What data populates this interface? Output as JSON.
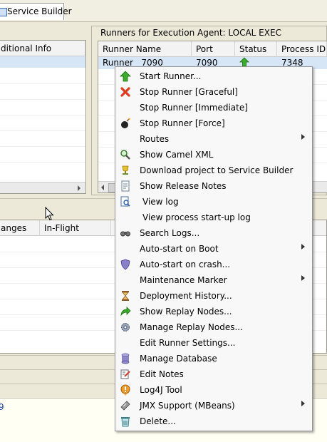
{
  "tab": {
    "label": "Service Builder"
  },
  "left_panel": {
    "col_header": "ditional Info"
  },
  "right_panel": {
    "title": "Runners for Execution Agent: LOCAL EXEC",
    "columns": [
      "Runner Name",
      "Port",
      "Status",
      "Process ID"
    ],
    "row": {
      "name": "Runner   7090",
      "port": "7090",
      "pid": "7348"
    }
  },
  "bottom_panel": {
    "columns": [
      "anges",
      "In-Flight"
    ]
  },
  "bottom_fragment": "9",
  "context_menu": {
    "items": [
      {
        "label": "Start Runner...",
        "icon": "green-up-arrow-icon",
        "submenu": false
      },
      {
        "label": "Stop Runner [Graceful]",
        "icon": "red-x-icon",
        "submenu": false
      },
      {
        "label": "Stop Runner [Immediate]",
        "icon": "",
        "submenu": false
      },
      {
        "label": "Stop Runner [Force]",
        "icon": "bomb-icon",
        "submenu": false
      },
      {
        "label": "Routes",
        "icon": "",
        "submenu": true
      },
      {
        "label": "Show Camel XML",
        "icon": "magnifier-icon",
        "submenu": false
      },
      {
        "label": "Download project to Service Builder",
        "icon": "trophy-icon",
        "submenu": false
      },
      {
        "label": "Show Release Notes",
        "icon": "document-icon",
        "submenu": false
      },
      {
        "label": "View log",
        "icon": "log-viewer-icon",
        "submenu": false
      },
      {
        "label": "View process start-up log",
        "icon": "",
        "submenu": false
      },
      {
        "label": "Search Logs...",
        "icon": "binoculars-icon",
        "submenu": false
      },
      {
        "label": "Auto-start on Boot",
        "icon": "",
        "submenu": true
      },
      {
        "label": "Auto-start on crash...",
        "icon": "shield-icon",
        "submenu": false
      },
      {
        "label": "Maintenance Marker",
        "icon": "",
        "submenu": true
      },
      {
        "label": "Deployment History...",
        "icon": "hourglass-icon",
        "submenu": false
      },
      {
        "label": "Show Replay Nodes...",
        "icon": "green-curved-arrow-icon",
        "submenu": false
      },
      {
        "label": "Manage Replay Nodes...",
        "icon": "gear-icon",
        "submenu": false
      },
      {
        "label": "Edit Runner Settings...",
        "icon": "",
        "submenu": false
      },
      {
        "label": "Manage Database",
        "icon": "database-icon",
        "submenu": false
      },
      {
        "label": "Edit Notes",
        "icon": "edit-notes-icon",
        "submenu": false
      },
      {
        "label": "Log4J Tool",
        "icon": "log4j-icon",
        "submenu": false
      },
      {
        "label": "JMX Support (MBeans)",
        "icon": "jmx-icon",
        "submenu": true
      },
      {
        "label": "Delete...",
        "icon": "recycle-bin-icon",
        "submenu": false
      }
    ]
  }
}
